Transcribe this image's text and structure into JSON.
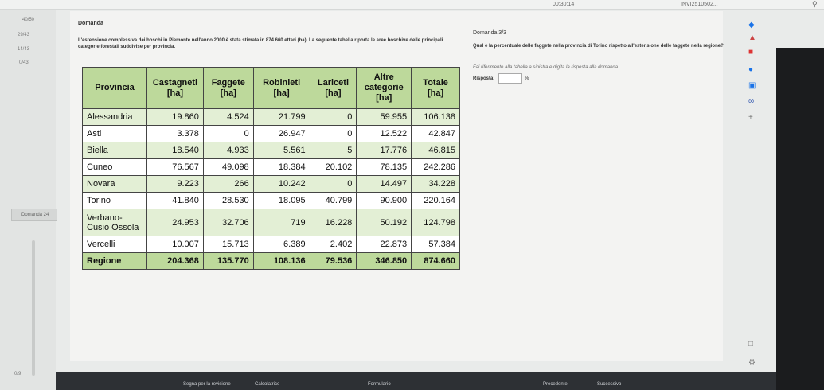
{
  "topbar": {
    "timer": "00:30:14",
    "user": "INVI2510502...",
    "search_icon": "search-icon"
  },
  "left": {
    "stats": [
      "40/50",
      "29/43",
      "14/43",
      "0/43",
      "0/9"
    ],
    "question_nav": "Domanda 24"
  },
  "content": {
    "title": "Domanda",
    "intro": "L'estensione complessiva dei boschi in Piemonte nell'anno 2000 è stata stimata in  874 660 ettari (ha). La seguente tabella riporta le aree boschive delle principali categorie forestali suddivise per provincia.",
    "right_title": "Domanda 3/3",
    "right_question": "Qual è la percentuale delle faggete nella provincia di Torino rispetto all'estensione delle faggete nella regione?",
    "reference": "Fai riferimento alla tabella a sinistra e digita la risposta alla domanda.",
    "answer_label": "Risposta:",
    "answer_value": "",
    "unit": "%"
  },
  "table": {
    "headers": [
      "Provincia",
      "Castagneti [ha]",
      "Faggete [ha]",
      "Robinieti [ha]",
      "Laricetl [ha]",
      "Altre categorie [ha]",
      "Totale [ha]"
    ],
    "rows": [
      [
        "Alessandria",
        "19.860",
        "4.524",
        "21.799",
        "0",
        "59.955",
        "106.138"
      ],
      [
        "Asti",
        "3.378",
        "0",
        "26.947",
        "0",
        "12.522",
        "42.847"
      ],
      [
        "Biella",
        "18.540",
        "4.933",
        "5.561",
        "5",
        "17.776",
        "46.815"
      ],
      [
        "Cuneo",
        "76.567",
        "49.098",
        "18.384",
        "20.102",
        "78.135",
        "242.286"
      ],
      [
        "Novara",
        "9.223",
        "266",
        "10.242",
        "0",
        "14.497",
        "34.228"
      ],
      [
        "Torino",
        "41.840",
        "28.530",
        "18.095",
        "40.799",
        "90.900",
        "220.164"
      ],
      [
        "Verbano-Cusio Ossola",
        "24.953",
        "32.706",
        "719",
        "16.228",
        "50.192",
        "124.798"
      ],
      [
        "Vercelli",
        "10.007",
        "15.713",
        "6.389",
        "2.402",
        "22.873",
        "57.384"
      ]
    ],
    "total": [
      "Regione",
      "204.368",
      "135.770",
      "108.136",
      "79.536",
      "346.850",
      "874.660"
    ]
  },
  "bottom": {
    "review": "Segna per la revisione",
    "calculator": "Calcolatrice",
    "formulary": "Formulario",
    "previous": "Precedente",
    "next": "Successivo"
  }
}
